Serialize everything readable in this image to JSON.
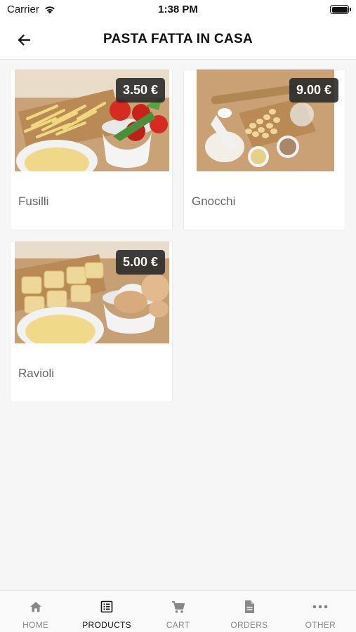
{
  "status_bar": {
    "carrier": "Carrier",
    "time": "1:38 PM"
  },
  "header": {
    "title": "PASTA FATTA IN CASA"
  },
  "products": [
    {
      "name": "Fusilli",
      "price": "3.50 €"
    },
    {
      "name": "Gnocchi",
      "price": "9.00 €"
    },
    {
      "name": "Ravioli",
      "price": "5.00 €"
    }
  ],
  "tab_bar": {
    "active": "PRODUCTS",
    "tabs": [
      {
        "label": "HOME",
        "icon": "home-icon"
      },
      {
        "label": "PRODUCTS",
        "icon": "list-icon"
      },
      {
        "label": "CART",
        "icon": "cart-icon"
      },
      {
        "label": "ORDERS",
        "icon": "document-icon"
      },
      {
        "label": "OTHER",
        "icon": "more-icon"
      }
    ]
  },
  "colors": {
    "active_tab": "#111111",
    "inactive_tab": "#888888",
    "price_badge": "#2a2a2a"
  }
}
